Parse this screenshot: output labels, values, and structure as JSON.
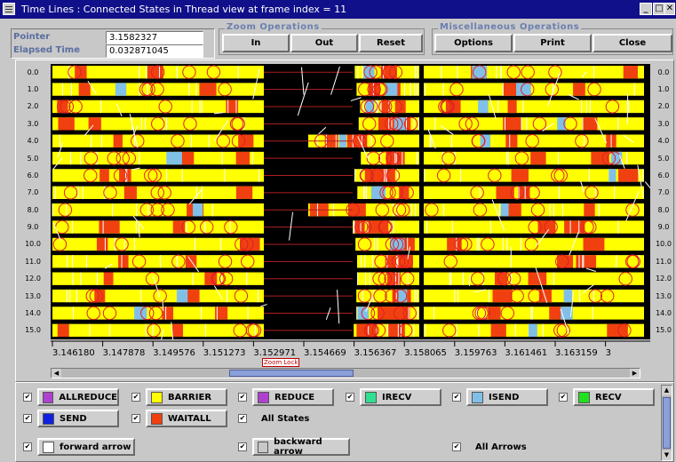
{
  "window": {
    "title": "Time Lines : Connected States in Thread view at frame index = 11"
  },
  "info": {
    "pointer_label": "Pointer",
    "pointer_value": "3.1582327",
    "elapsed_label": "Elapsed Time",
    "elapsed_value": "0.032871045"
  },
  "zoom": {
    "title": "Zoom Operations",
    "in": "In",
    "out": "Out",
    "reset": "Reset"
  },
  "misc": {
    "title": "Miscellaneous Operations",
    "options": "Options",
    "print": "Print",
    "close": "Close"
  },
  "ranks": [
    "0.0",
    "1.0",
    "2.0",
    "3.0",
    "4.0",
    "5.0",
    "6.0",
    "7.0",
    "8.0",
    "9.0",
    "10.0",
    "11.0",
    "12.0",
    "13.0",
    "14.0",
    "15.0"
  ],
  "axis": {
    "ticks": [
      "3.146180",
      "3.147878",
      "3.149576",
      "3.151273",
      "3.152971",
      "3.154669",
      "3.156367",
      "3.158065",
      "3.159763",
      "3.161461",
      "3.163159",
      "3"
    ],
    "zoom_lock": "Zoom Lock"
  },
  "legend": {
    "states": [
      {
        "label": "ALLREDUCE",
        "color": "#b040d0"
      },
      {
        "label": "BARRIER",
        "color": "#ffff00"
      },
      {
        "label": "REDUCE",
        "color": "#b040d0"
      },
      {
        "label": "IRECV",
        "color": "#30e090"
      },
      {
        "label": "ISEND",
        "color": "#80c0e8"
      },
      {
        "label": "RECV",
        "color": "#20e020"
      },
      {
        "label": "SEND",
        "color": "#1020e0"
      },
      {
        "label": "WAITALL",
        "color": "#f04010"
      }
    ],
    "all_states": "All States",
    "arrows": [
      {
        "label": "forward arrow",
        "color": "#ffffff"
      },
      {
        "label": "backward arrow",
        "color": "#c8c8c8"
      }
    ],
    "all_arrows": "All Arrows"
  },
  "colors": {
    "barrier": "#ffff00",
    "waitall": "#f04010",
    "isend": "#80c0e8",
    "irecv": "#30e090",
    "recv": "#20e020",
    "background": "#000000",
    "circle": "#e02020"
  }
}
